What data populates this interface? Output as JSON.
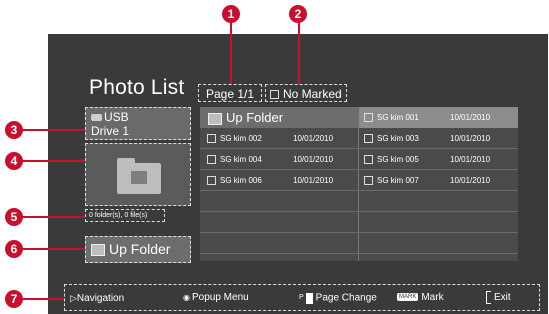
{
  "title": "Photo List",
  "page_badge": "Page 1/1",
  "marked_badge": "No Marked",
  "device": {
    "line1": "USB",
    "line2": "Drive 1"
  },
  "folder_count": "0 folder(s), 0 file(s)",
  "up_folder_left": "Up Folder",
  "up_folder_list": "Up Folder",
  "items": [
    {
      "name": "SG kim 001",
      "date": "10/01/2010"
    },
    {
      "name": "SG kim 002",
      "date": "10/01/2010"
    },
    {
      "name": "SG kim 003",
      "date": "10/01/2010"
    },
    {
      "name": "SG kim 004",
      "date": "10/01/2010"
    },
    {
      "name": "SG kim 005",
      "date": "10/01/2010"
    },
    {
      "name": "SG kim 006",
      "date": "10/01/2010"
    },
    {
      "name": "SG kim 007",
      "date": "10/01/2010"
    }
  ],
  "footer": {
    "navigation": "Navigation",
    "popup": "Popup Menu",
    "page": "Page Change",
    "mark_key": "MARK",
    "mark": "Mark",
    "exit": "Exit"
  },
  "callouts": [
    "1",
    "2",
    "3",
    "4",
    "5",
    "6",
    "7"
  ],
  "colors": {
    "callout": "#c8102e",
    "background": "#3a3a3a"
  }
}
